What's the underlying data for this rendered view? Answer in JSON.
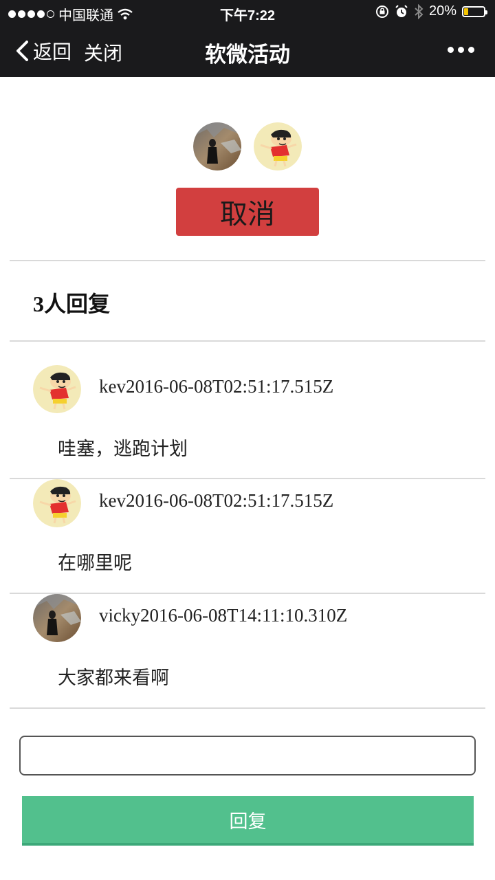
{
  "status_bar": {
    "carrier": "中国联通",
    "time": "下午7:22",
    "battery_percent": "20%",
    "battery_level": 0.2,
    "icons": [
      "signal-dots-icon",
      "wifi-icon",
      "rotation-lock-icon",
      "alarm-icon",
      "bluetooth-icon",
      "battery-icon"
    ]
  },
  "nav": {
    "back_label": "返回",
    "close_label": "关闭",
    "title": "软微活动",
    "more_icon": "more-dots-icon"
  },
  "participants": {
    "avatars": [
      "photo-avatar",
      "cartoon-avatar"
    ]
  },
  "cancel_label": "取消",
  "reply_count": "3人回复",
  "comments": [
    {
      "author": "kev",
      "timestamp": "2016-06-08T02:51:17.515Z",
      "meta": "kev2016-06-08T02:51:17.515Z",
      "text": "哇塞，逃跑计划",
      "avatar": "cartoon-avatar"
    },
    {
      "author": "kev",
      "timestamp": "2016-06-08T02:51:17.515Z",
      "meta": "kev2016-06-08T02:51:17.515Z",
      "text": "在哪里呢",
      "avatar": "cartoon-avatar"
    },
    {
      "author": "vicky",
      "timestamp": "2016-06-08T14:11:10.310Z",
      "meta": "vicky2016-06-08T14:11:10.310Z",
      "text": "大家都来看啊",
      "avatar": "photo-avatar"
    }
  ],
  "reply_input": {
    "value": "",
    "placeholder": ""
  },
  "reply_button_label": "回复",
  "colors": {
    "nav_bg": "#1a1a1c",
    "cancel_bg": "#d23f3f",
    "reply_bg": "#52c08d",
    "battery_fill": "#f4c400",
    "divider": "#d9d9d9"
  }
}
